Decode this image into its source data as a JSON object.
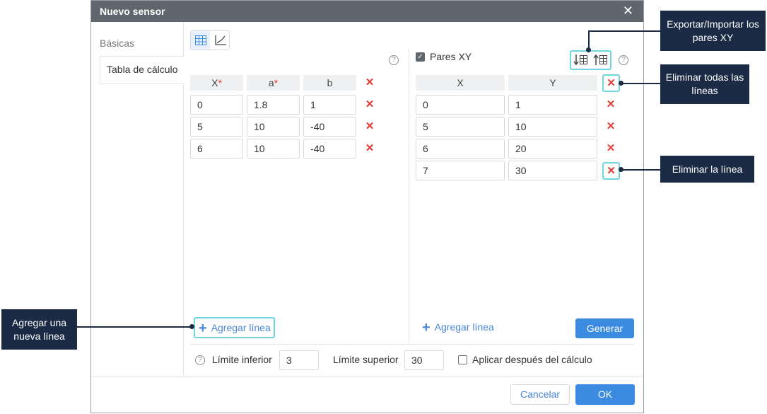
{
  "dialog": {
    "title": "Nuevo sensor",
    "close_glyph": "✕",
    "tabs": [
      "Básicas",
      "Tabla de cálculo"
    ],
    "help_glyph": "?",
    "left_table": {
      "headers": [
        "X",
        "a",
        "b"
      ],
      "required_mark": "*",
      "rows": [
        [
          "0",
          "1.8",
          "1"
        ],
        [
          "5",
          "10",
          "-40"
        ],
        [
          "6",
          "10",
          "-40"
        ]
      ],
      "delete_glyph": "✕"
    },
    "pairs": {
      "checkbox_label": "Pares XY",
      "checked": true,
      "headers": [
        "X",
        "Y"
      ],
      "rows": [
        [
          "0",
          "1"
        ],
        [
          "5",
          "10"
        ],
        [
          "6",
          "20"
        ],
        [
          "7",
          "30"
        ]
      ]
    },
    "add_line_label": "Agregar línea",
    "generate_label": "Generar",
    "lower_limit_label": "Límite inferior",
    "lower_limit_value": "3",
    "upper_limit_label": "Límite superior",
    "upper_limit_value": "30",
    "apply_after_label": "Aplicar después del cálculo",
    "apply_after_checked": false,
    "cancel_label": "Cancelar",
    "ok_label": "OK"
  },
  "callouts": {
    "export_import": "Exportar/Importar los pares XY",
    "delete_all": "Eliminar todas las líneas",
    "delete_line": "Eliminar la línea",
    "add_new_line": "Agregar una nueva línea"
  },
  "icons": [
    "table-view-icon",
    "chart-view-icon",
    "export-icon",
    "import-icon",
    "help-icon",
    "close-icon",
    "delete-icon",
    "plus-icon",
    "check-icon"
  ],
  "colors": {
    "accent": "#3b8be0",
    "delete": "#e53935",
    "highlight": "#6fd6e0",
    "callout": "#1b2b45",
    "titlebar": "#5f666d"
  }
}
